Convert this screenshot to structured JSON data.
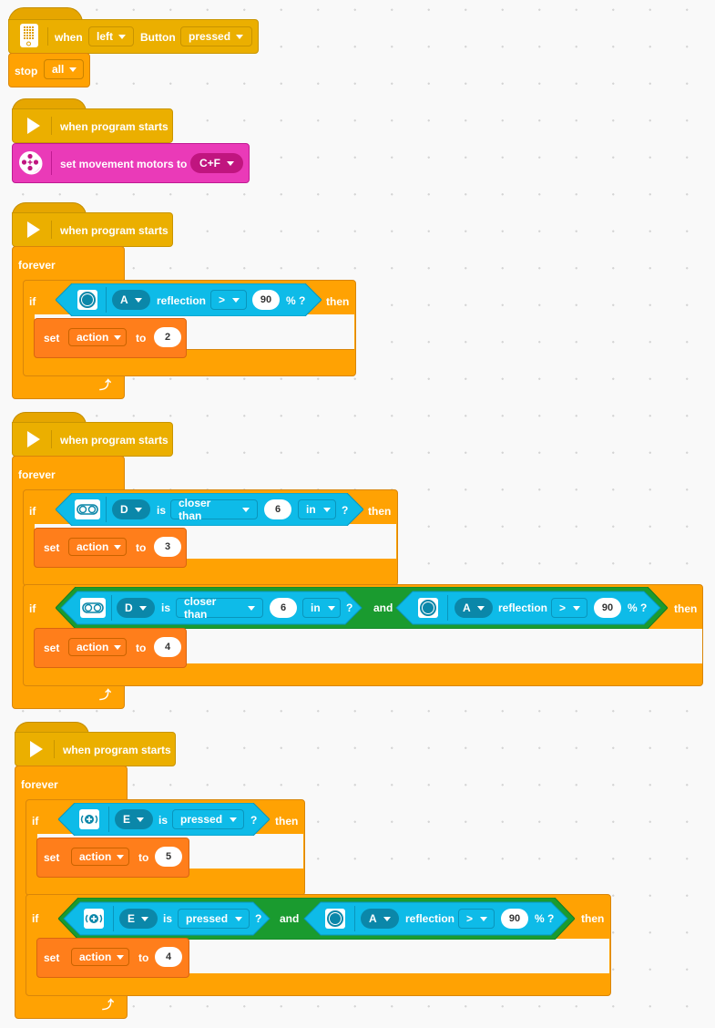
{
  "stack1": {
    "hat": {
      "icon": "hub-icon",
      "when": "when",
      "button_side": "left",
      "button_label": "Button",
      "state": "pressed"
    },
    "stop": {
      "label": "stop",
      "value": "all"
    }
  },
  "stack2": {
    "hat": {
      "icon": "play-icon",
      "label": "when program starts"
    },
    "motors": {
      "icon": "motor-pair-icon",
      "label": "set movement motors to",
      "value": "C+F"
    }
  },
  "stack3": {
    "hat": {
      "label": "when program starts"
    },
    "forever": "forever",
    "if1": {
      "if": "if",
      "then": "then",
      "cond": {
        "icon": "color-sensor-icon",
        "port": "A",
        "measure": "reflection",
        "op": ">",
        "value": "90",
        "unit": "% ?"
      },
      "set": {
        "label": "set",
        "var": "action",
        "to": "to",
        "value": "2"
      }
    }
  },
  "stack4": {
    "hat": {
      "label": "when program starts"
    },
    "forever": "forever",
    "if1": {
      "if": "if",
      "then": "then",
      "cond": {
        "icon": "distance-sensor-icon",
        "port": "D",
        "is": "is",
        "compare": "closer than",
        "value": "6",
        "unit": "in",
        "q": "?"
      },
      "set": {
        "label": "set",
        "var": "action",
        "to": "to",
        "value": "3"
      }
    },
    "if2": {
      "if": "if",
      "then": "then",
      "and": "and",
      "cond1": {
        "port": "D",
        "is": "is",
        "compare": "closer than",
        "value": "6",
        "unit": "in",
        "q": "?"
      },
      "cond2": {
        "port": "A",
        "measure": "reflection",
        "op": ">",
        "value": "90",
        "unit": "% ?"
      },
      "set": {
        "label": "set",
        "var": "action",
        "to": "to",
        "value": "4"
      }
    }
  },
  "stack5": {
    "hat": {
      "label": "when program starts"
    },
    "forever": "forever",
    "if1": {
      "if": "if",
      "then": "then",
      "cond": {
        "icon": "force-sensor-icon",
        "port": "E",
        "is": "is",
        "state": "pressed",
        "q": "?"
      },
      "set": {
        "label": "set",
        "var": "action",
        "to": "to",
        "value": "5"
      }
    },
    "if2": {
      "if": "if",
      "then": "then",
      "and": "and",
      "cond1": {
        "port": "E",
        "is": "is",
        "state": "pressed",
        "q": "?"
      },
      "cond2": {
        "port": "A",
        "measure": "reflection",
        "op": ">",
        "value": "90",
        "unit": "% ?"
      },
      "set": {
        "label": "set",
        "var": "action",
        "to": "to",
        "value": "4"
      }
    }
  },
  "colors": {
    "events": "#ebaf00",
    "control": "#ffa203",
    "variables": "#ff7e1b",
    "sensors": "#0ebbe8",
    "operators": "#1a9b2f",
    "motors": "#ea3ab8"
  }
}
